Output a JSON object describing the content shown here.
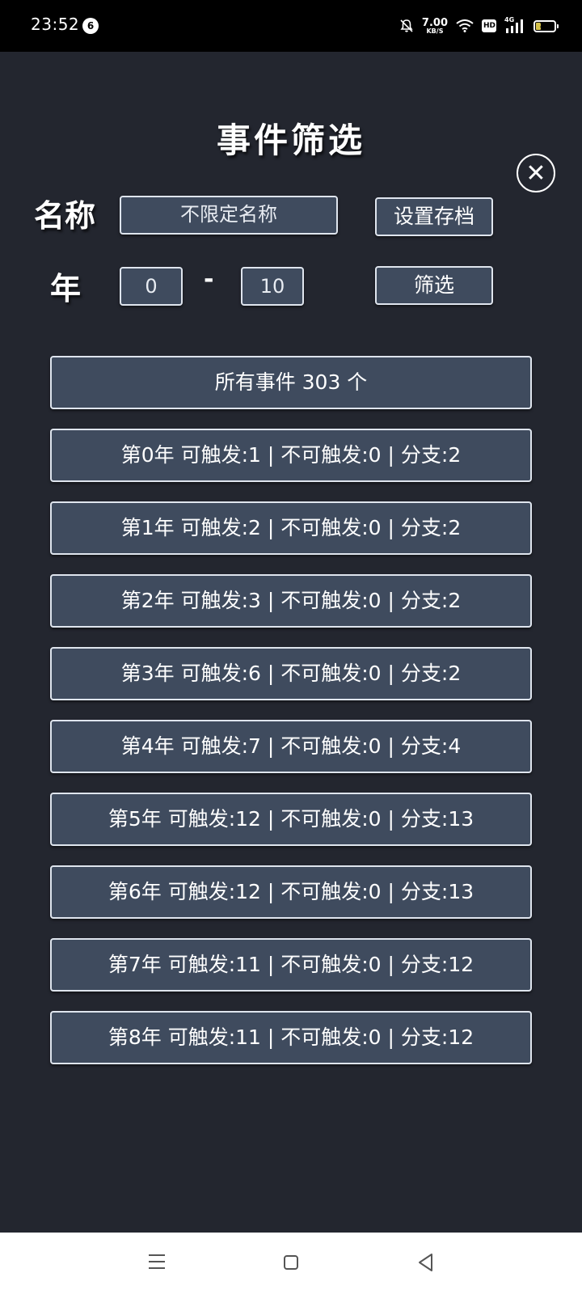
{
  "status_bar": {
    "time": "23:52",
    "notification_count": "6",
    "net_speed_value": "7.00",
    "net_speed_unit": "KB/S",
    "hd_label": "HD",
    "signal_label": "4G",
    "battery_level": "28",
    "battery_fraction": 0.28,
    "battery_color": "#d5c24a"
  },
  "panel": {
    "title": "事件筛选",
    "close_icon": "close-icon",
    "name_label": "名称",
    "name_input_value": "不限定名称",
    "set_save_button": "设置存档",
    "year_label": "年",
    "year_from": "0",
    "year_separator": "-",
    "year_to": "10",
    "filter_button": "筛选"
  },
  "events": {
    "all_events": "所有事件 303 个",
    "rows": [
      "第0年 可触发:1 | 不可触发:0 | 分支:2",
      "第1年 可触发:2 | 不可触发:0 | 分支:2",
      "第2年 可触发:3 | 不可触发:0 | 分支:2",
      "第3年 可触发:6 | 不可触发:0 | 分支:2",
      "第4年 可触发:7 | 不可触发:0 | 分支:4",
      "第5年 可触发:12 | 不可触发:0 | 分支:13",
      "第6年 可触发:12 | 不可触发:0 | 分支:13",
      "第7年 可触发:11 | 不可触发:0 | 分支:12",
      "第8年 可触发:11 | 不可触发:0 | 分支:12"
    ]
  },
  "nav_bar": {
    "menu_icon": "menu-icon",
    "home_icon": "home-icon",
    "back_icon": "back-icon"
  },
  "colors": {
    "background": "#23262f",
    "button_fill": "#3f4b5e",
    "button_border": "#dfe5ee",
    "text": "#ffffff"
  }
}
